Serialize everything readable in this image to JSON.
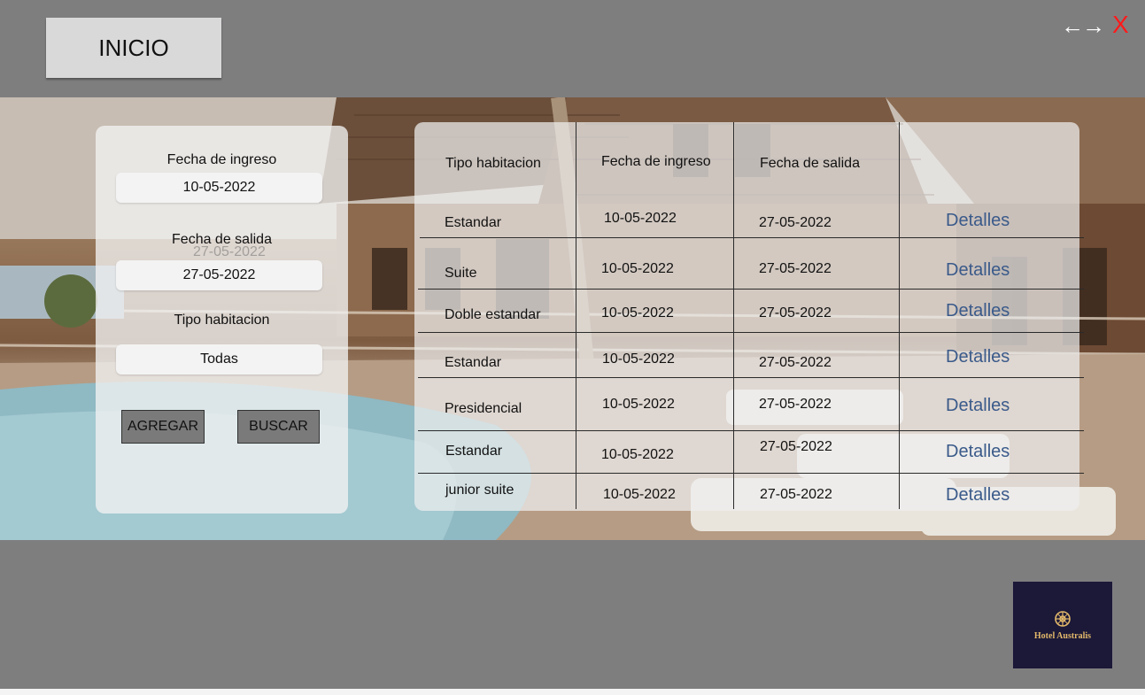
{
  "header": {
    "home_label": "INICIO",
    "nav_arrows": "←→",
    "close_label": "X"
  },
  "search": {
    "checkin_label": "Fecha de ingreso",
    "checkin_value": "10-05-2022",
    "checkout_label": "Fecha de salida",
    "checkout_value": "27-05-2022",
    "checkout_ghost": "27-05-2022",
    "room_type_label": "Tipo habitacion",
    "room_type_value": "Todas",
    "add_label": "AGREGAR",
    "search_label": "BUSCAR"
  },
  "table": {
    "headers": [
      "Tipo habitacion",
      "Fecha de ingreso",
      "Fecha de salida"
    ],
    "rows": [
      {
        "type": "Estandar",
        "checkin": "10-05-2022",
        "checkout": "27-05-2022",
        "action": "Detalles"
      },
      {
        "type": "Suite",
        "checkin": "10-05-2022",
        "checkout": "27-05-2022",
        "action": "Detalles"
      },
      {
        "type": "Doble estandar",
        "checkin": "10-05-2022",
        "checkout": "27-05-2022",
        "action": "Detalles"
      },
      {
        "type": "Estandar",
        "checkin": "10-05-2022",
        "checkout": "27-05-2022",
        "action": "Detalles"
      },
      {
        "type": "Presidencial",
        "checkin": "10-05-2022",
        "checkout": "27-05-2022",
        "action": "Detalles"
      },
      {
        "type": "Estandar",
        "checkin": "10-05-2022",
        "checkout": "27-05-2022",
        "action": "Detalles"
      },
      {
        "type": "junior suite",
        "checkin": "10-05-2022",
        "checkout": "27-05-2022",
        "action": "Detalles"
      }
    ]
  },
  "brand": {
    "name": "Hotel Australis",
    "icon": "compass-rose-icon",
    "background": "#1b1838",
    "accent": "#e2b86a"
  },
  "colors": {
    "bars": "#7f7e7f",
    "link": "#3a5a8a",
    "close": "#ff1a1a"
  }
}
